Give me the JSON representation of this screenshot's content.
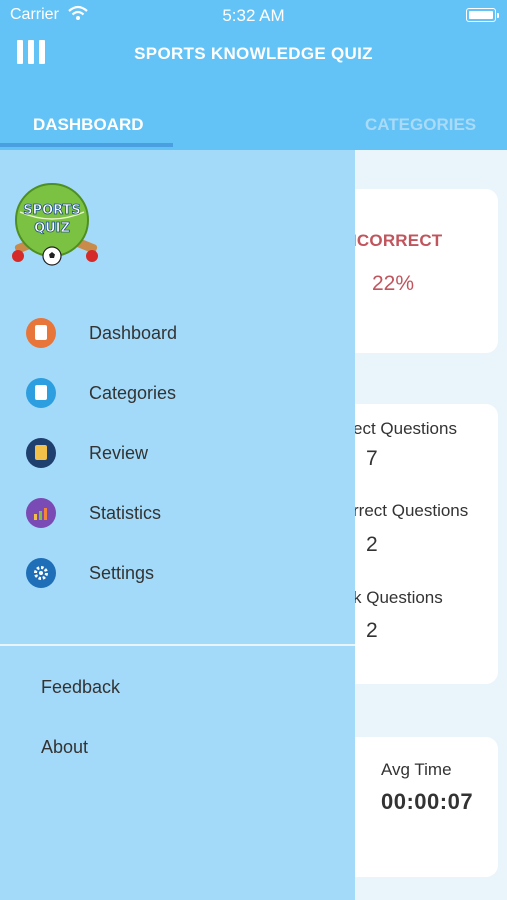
{
  "status_bar": {
    "carrier": "Carrier",
    "time": "5:32 AM"
  },
  "header": {
    "title": "SPORTS KNOWLEDGE QUIZ",
    "tabs": [
      {
        "label": "DASHBOARD",
        "active": true
      },
      {
        "label": "CATEGORIES",
        "active": false
      }
    ]
  },
  "background": {
    "incorrect_label": "ICORRECT",
    "incorrect_value": "22%",
    "questions": [
      {
        "label": "ect Questions",
        "value": "7"
      },
      {
        "label": "rrect Questions",
        "value": "2"
      },
      {
        "label": "k Questions",
        "value": "2"
      }
    ],
    "avg_time_label": "Avg Time",
    "avg_time_value": "00:00:07"
  },
  "drawer": {
    "logo_text_top": "SPORTS",
    "logo_text_bottom": "QUIZ",
    "nav_items": [
      {
        "label": "Dashboard",
        "icon": "dashboard-icon",
        "color": "#e8763a"
      },
      {
        "label": "Categories",
        "icon": "categories-icon",
        "color": "#2d9fe0"
      },
      {
        "label": "Review",
        "icon": "review-icon",
        "color": "#1f3f6e"
      },
      {
        "label": "Statistics",
        "icon": "statistics-icon",
        "color": "#7b4bb5"
      },
      {
        "label": "Settings",
        "icon": "settings-icon",
        "color": "#1f6fb8"
      }
    ],
    "links": [
      {
        "label": "Feedback"
      },
      {
        "label": "About"
      }
    ]
  },
  "colors": {
    "header": "#63c3f6",
    "drawer": "#a4daf9",
    "incorrect": "#c0555d"
  }
}
